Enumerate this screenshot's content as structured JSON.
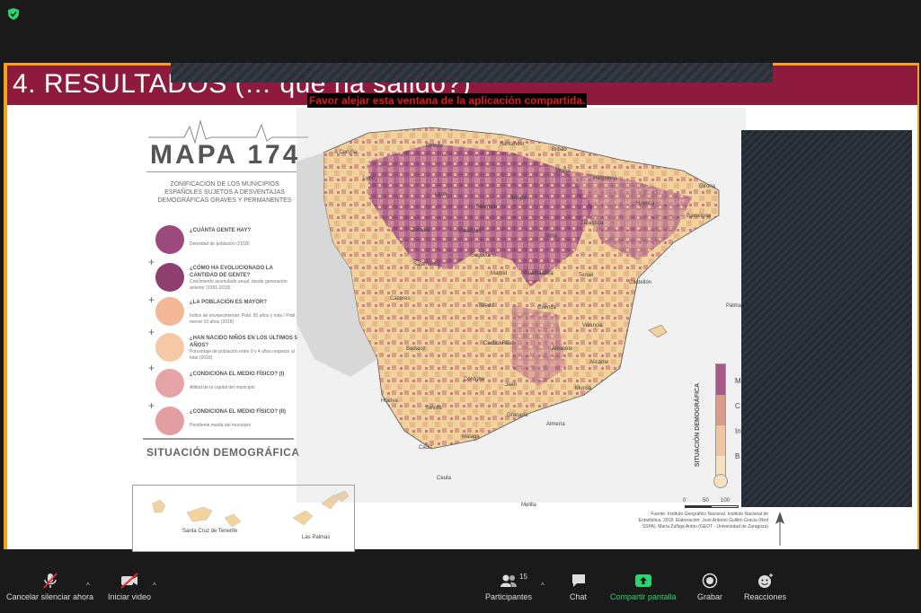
{
  "slide": {
    "title": "4. RESULTADOS (… que ha salido?)",
    "warning": "Favor alejar esta ventana de la aplicación compartida."
  },
  "panel": {
    "mapa_title": "MAPA 174",
    "subtitle": "ZONIFICACIÓN DE LOS MUNICIPIOS ESPAÑOLES SUJETOS A DESVENTAJAS DEMOGRÁFICAS GRAVES Y PERMANENTES",
    "questions": [
      {
        "title": "¿CUÁNTA GENTE HAY?",
        "desc": "Densidad de población (2018)",
        "color": "#9c4a7d"
      },
      {
        "title": "¿CÓMO HA EVOLUCIONADO LA CANTIDAD DE GENTE?",
        "desc": "Crecimiento acumulado anual, desde generación anterior (1991-2018)",
        "color": "#8e3f70"
      },
      {
        "title": "¿LA POBLACIÓN ES MAYOR?",
        "desc": "Índice de envejecimiento: Pobl. 65 años y más / Pobl. menor 15 años (2018)",
        "color": "#f2b898"
      },
      {
        "title": "¿HAN NACIDO NIÑOS EN LOS ÚLTIMOS 5 AÑOS?",
        "desc": "Porcentaje de población entre 0 y 4 años respecto al total (2018)",
        "color": "#f5c9a8"
      },
      {
        "title": "¿CONDICIONA EL MEDIO FÍSICO? (I)",
        "desc": "Altitud de la capital del municipio",
        "color": "#e7a4a6"
      },
      {
        "title": "¿CONDICIONA EL MEDIO FÍSICO? (II)",
        "desc": "Pendiente media del municipio",
        "color": "#e39ea2"
      }
    ],
    "situacion": "SITUACIÓN DEMOGRÁFICA"
  },
  "map": {
    "cities": [
      "A Coruña",
      "Santander",
      "Oviedo",
      "Bilbao",
      "Lugo",
      "León",
      "Burgos",
      "Vitoria",
      "Pamplona",
      "Huesca",
      "Girona",
      "Barcelona",
      "Zaragoza",
      "Palencia",
      "Valladolid",
      "Soria",
      "Zamora",
      "Salamanca",
      "Segovia",
      "Guadalajara",
      "Madrid",
      "Teruel",
      "Castellón",
      "Cáceres",
      "Toledo",
      "Cuenca",
      "Valencia",
      "Badajoz",
      "Ciudad Real",
      "Albacete",
      "Alicante",
      "Córdoba",
      "Jaén",
      "Murcia",
      "Huelva",
      "Sevilla",
      "Granada",
      "Almería",
      "Cádiz",
      "Málaga",
      "Ceuta",
      "Melilla",
      "Palma"
    ],
    "legend_title": "SITUACIÓN DEMOGRÁFICA",
    "legend_labels": [
      "M",
      "C",
      "In",
      "B"
    ],
    "scale": [
      "0",
      "50",
      "100"
    ],
    "source": "Fuente: Instituto Geográfico Nacional. Instituto Nacional de Estadística, 2018. Elaboración: José Antonio Guillén Gracia (Red SSPA). María Zúñiga Antón (GEOT - Universidad de Zaragoza)",
    "inset_labels": [
      "Santa Cruz de Tenerife",
      "Las Palmas"
    ]
  },
  "toolbar": {
    "mute": "Cancelar silenciar ahora",
    "video": "Iniciar video",
    "participants": "Participantes",
    "participants_count": "15",
    "chat": "Chat",
    "share": "Compartir pantalla",
    "record": "Grabar",
    "reactions": "Reacciones"
  }
}
